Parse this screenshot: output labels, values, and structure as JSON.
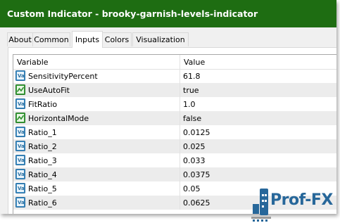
{
  "window": {
    "title": "Custom Indicator - brooky-garnish-levels-indicator"
  },
  "tabs": [
    {
      "label": "About"
    },
    {
      "label": "Common"
    },
    {
      "label": "Inputs"
    },
    {
      "label": "Colors"
    },
    {
      "label": "Visualization"
    }
  ],
  "active_tab": "Inputs",
  "grid": {
    "headers": {
      "variable": "Variable",
      "value": "Value"
    },
    "rows": [
      {
        "name": "SensitivityPercent",
        "value": "61.8",
        "icon": "double-value-icon"
      },
      {
        "name": "UseAutoFit",
        "value": "true",
        "icon": "boolean-value-icon"
      },
      {
        "name": "FitRatio",
        "value": "1.0",
        "icon": "double-value-icon"
      },
      {
        "name": "HorizontalMode",
        "value": "false",
        "icon": "boolean-value-icon"
      },
      {
        "name": "Ratio_1",
        "value": "0.0125",
        "icon": "double-value-icon"
      },
      {
        "name": "Ratio_2",
        "value": "0.025",
        "icon": "double-value-icon"
      },
      {
        "name": "Ratio_3",
        "value": "0.033",
        "icon": "double-value-icon"
      },
      {
        "name": "Ratio_4",
        "value": "0.0375",
        "icon": "double-value-icon"
      },
      {
        "name": "Ratio_5",
        "value": "0.05",
        "icon": "double-value-icon"
      },
      {
        "name": "Ratio_6",
        "value": "0.0625",
        "icon": "double-value-icon"
      }
    ]
  },
  "watermark": {
    "text": "Prof-FX",
    "icon": "prof-fx-logo-icon"
  },
  "colors": {
    "title_bar": "#1e6d12",
    "row_alt": "#ececec",
    "logo": "#27679a",
    "double_icon": "#3f8fc6",
    "bool_icon": "#3aa33a"
  }
}
